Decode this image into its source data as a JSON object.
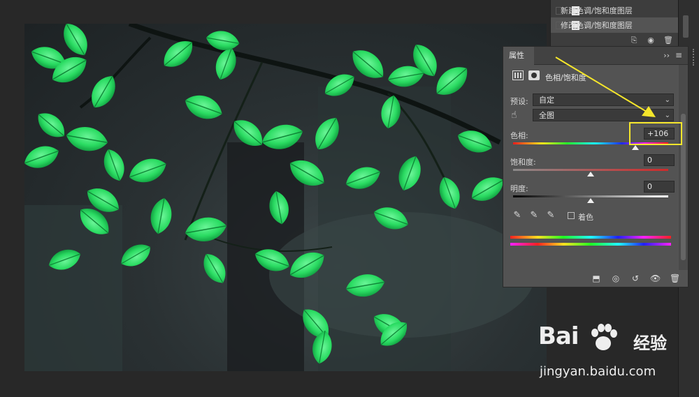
{
  "history": {
    "items": [
      {
        "label": "新建色调/饱和度图层"
      },
      {
        "label": "修改色调/饱和度图层"
      }
    ]
  },
  "properties": {
    "tab_label": "属性",
    "collapse_glyph": "››",
    "menu_glyph": "≡",
    "adjustment_title": "色相/饱和度",
    "preset_label": "预设:",
    "preset_value": "自定",
    "channel_value": "全图",
    "hue_label": "色相:",
    "hue_value": "+106",
    "hue_level": 0.79,
    "saturation_label": "饱和度:",
    "saturation_value": "0",
    "saturation_level": 0.5,
    "lightness_label": "明度:",
    "lightness_value": "0",
    "lightness_level": 0.5,
    "colorize_label": "着色"
  },
  "annotation": {
    "highlight_color": "#f5e62b"
  },
  "watermark": {
    "logo_text": "Bai",
    "logo_suffix": "经验",
    "url": "jingyan.baidu.com"
  },
  "colors": {
    "panel_bg": "#535353",
    "app_bg": "#282828",
    "leaf_green": "#2ee86a"
  }
}
